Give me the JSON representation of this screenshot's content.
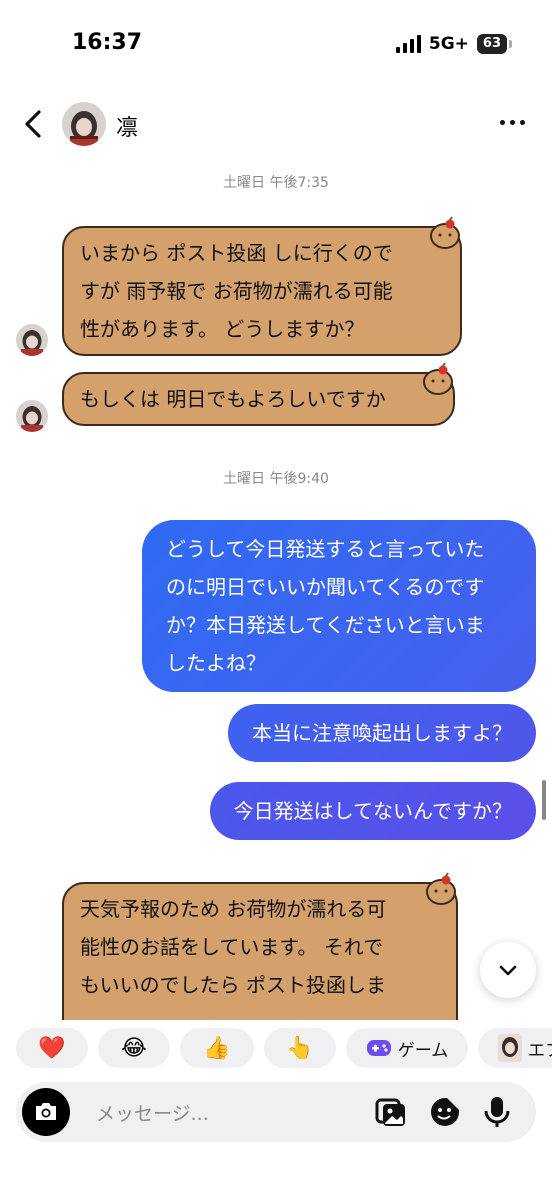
{
  "status_bar": {
    "time": "16:37",
    "network": "5G+",
    "battery": "63"
  },
  "header": {
    "contact_name": "凛"
  },
  "chat": {
    "timestamp_1": "土曜日 午後7:35",
    "timestamp_2": "土曜日 午後9:40",
    "received_1": [
      "いまから ポスト投函 しに行くので",
      "すが 雨予報で お荷物が濡れる可能",
      "性があります。 どうしますか？"
    ],
    "received_2": [
      "もしくは 明日でもよろしいですか"
    ],
    "sent_1": [
      "どうして今日発送すると言っていた",
      "のに明日でいいか聞いてくるのです",
      "か？本日発送してくださいと言いま",
      "したよね？"
    ],
    "sent_2": [
      "本当に注意喚起出しますよ？"
    ],
    "sent_3": [
      "今日発送はしてないんですか？"
    ],
    "received_3": [
      "天気予報のため お荷物が濡れる可",
      "能性のお話をしています。 それで",
      "もいいのでしたら ポスト投函しま"
    ]
  },
  "quick_reactions": {
    "heart": "❤️",
    "laugh": "😂",
    "thumbs": "👍",
    "point": "👆",
    "game_label": "ゲーム",
    "effect_label": "エフ"
  },
  "composer": {
    "placeholder": "メッセージ..."
  },
  "colors": {
    "received_bubble": "#d4a16c",
    "received_border": "#3b2a1d",
    "sent_gradient_start": "#2f6bf2",
    "sent_gradient_end": "#5a4fe8",
    "game_icon": "#6a4cf0"
  },
  "icons": [
    "back-chevron-icon",
    "more-dots-icon",
    "camera-icon",
    "gallery-icon",
    "sticker-icon",
    "microphone-icon",
    "chevron-down-icon",
    "game-controller-icon",
    "capybara-icon"
  ]
}
